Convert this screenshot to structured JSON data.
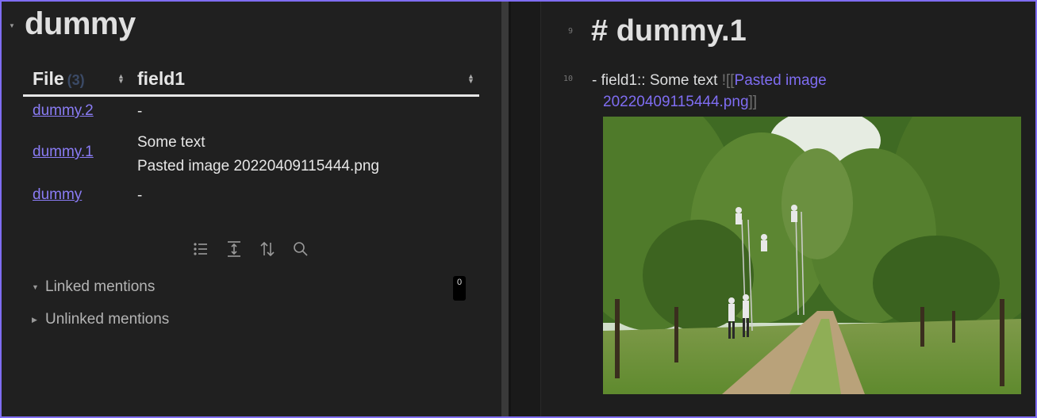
{
  "left_pane": {
    "title": "dummy",
    "table": {
      "headers": {
        "file": "File",
        "count": "(3)",
        "field": "field1"
      },
      "rows": [
        {
          "file": "dummy.2",
          "value_lines": [
            "-"
          ]
        },
        {
          "file": "dummy.1",
          "value_lines": [
            "Some text",
            "Pasted image 20220409115444.png"
          ]
        },
        {
          "file": "dummy",
          "value_lines": [
            "-"
          ]
        }
      ]
    },
    "toolbar": {
      "icons": [
        "list-icon",
        "expand-vertical-icon",
        "sort-icon",
        "search-icon"
      ]
    },
    "linked_mentions": {
      "label": "Linked mentions",
      "count": "0"
    },
    "unlinked_mentions": {
      "label": "Unlinked mentions"
    }
  },
  "right_pane": {
    "line_numbers": {
      "heading": "9",
      "field": "10"
    },
    "heading": "# dummy.1",
    "field_line": {
      "prefix": "- field1:: Some text ",
      "open_brackets": "![[",
      "link_line1": "Pasted image",
      "link_line2": "20220409115444.png",
      "close_brackets": "]]"
    },
    "embedded_image": "orchard-photo"
  },
  "colors": {
    "accent": "#7f6df2",
    "link": "#8a7cf5",
    "background": "#1e1e1e"
  }
}
